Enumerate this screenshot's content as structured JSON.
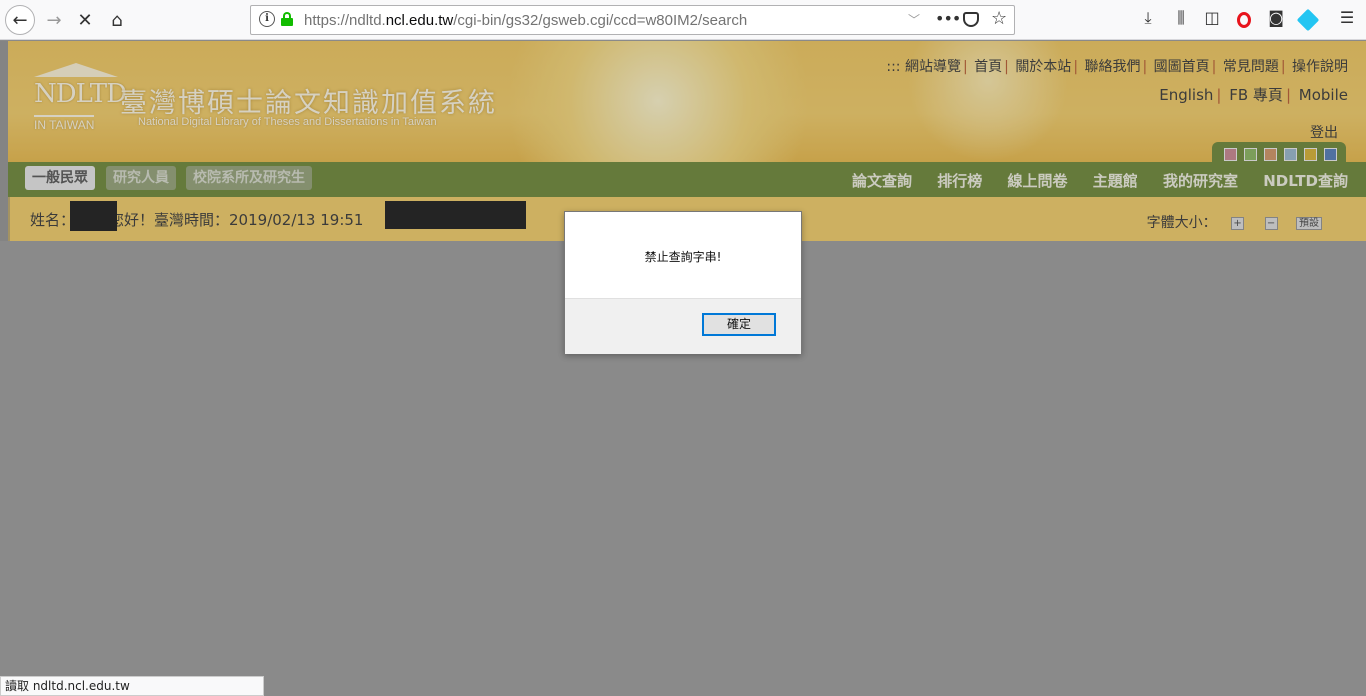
{
  "browser": {
    "url_prefix": "https://ndltd.",
    "url_host": "ncl.edu.tw",
    "url_path": "/cgi-bin/gs32/gsweb.cgi/ccd=w80IM2/search"
  },
  "site": {
    "logo_abbrev": "NDLTD",
    "logo_sub": "IN TAIWAN",
    "title_zh": "臺灣博碩士論文知識加值系統",
    "title_en": "National Digital Library of Theses and Dissertations in Taiwan",
    "top_links": [
      "::: 網站導覽",
      "首頁",
      "關於本站",
      "聯絡我們",
      "國圖首頁",
      "常見問題",
      "操作說明"
    ],
    "lang_links": [
      "English",
      "FB 專頁",
      "Mobile"
    ],
    "logout": "登出",
    "swatch_colors": [
      "#c47a86",
      "#7eaf4f",
      "#cf8a55",
      "#8fb0c9",
      "#d6ab1c",
      "#3f6fb4"
    ],
    "role_tabs": [
      "一般民眾",
      "研究人員",
      "校院系所及研究生"
    ],
    "main_nav": [
      "論文查詢",
      "排行榜",
      "線上問卷",
      "主題館",
      "我的研究室",
      "NDLTD查詢"
    ],
    "greeting_name_label": "姓名：",
    "greeting_rest": "您好！臺灣時間：2019/02/13 19:51",
    "font_size_label": "字體大小：",
    "font_plus": "+",
    "font_minus": "−",
    "font_default": "預設"
  },
  "dialog": {
    "message": "禁止查詢字串!",
    "ok_label": "確定"
  },
  "status_bar": "讀取 ndltd.ncl.edu.tw"
}
